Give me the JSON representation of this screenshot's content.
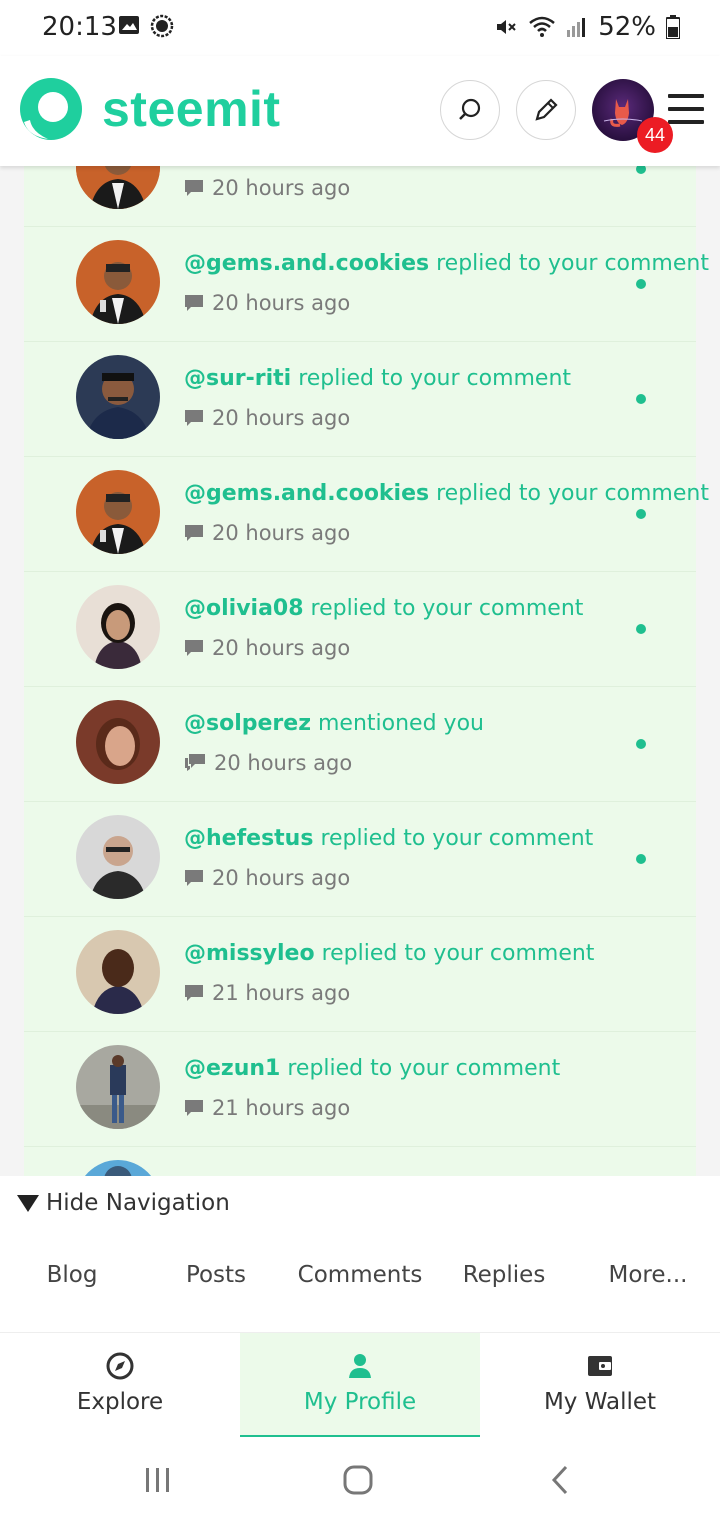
{
  "status_bar": {
    "time": "20:13",
    "battery": "52%",
    "icons": [
      "gallery-icon",
      "messenger-icon",
      "mute-icon",
      "wifi-icon",
      "signal-icon",
      "battery-icon"
    ]
  },
  "header": {
    "logo_text": "steemit",
    "notification_count": "44",
    "brand_color": "#1fcf9e"
  },
  "notifications": [
    {
      "user": "",
      "action": "",
      "time": "20 hours ago",
      "unread": true,
      "icon": "comment-icon"
    },
    {
      "user": "@gems.and.cookies",
      "action": "replied to your comment",
      "time": "20 hours ago",
      "unread": true,
      "icon": "comment-icon"
    },
    {
      "user": "@sur-riti",
      "action": "replied to your comment",
      "time": "20 hours ago",
      "unread": true,
      "icon": "comment-icon"
    },
    {
      "user": "@gems.and.cookies",
      "action": "replied to your comment",
      "time": "20 hours ago",
      "unread": true,
      "icon": "comment-icon"
    },
    {
      "user": "@olivia08",
      "action": "replied to your comment",
      "time": "20 hours ago",
      "unread": true,
      "icon": "comment-icon"
    },
    {
      "user": "@solperez",
      "action": "mentioned you",
      "time": "20 hours ago",
      "unread": true,
      "icon": "mention-icon"
    },
    {
      "user": "@hefestus",
      "action": "replied to your comment",
      "time": "20 hours ago",
      "unread": true,
      "icon": "comment-icon"
    },
    {
      "user": "@missyleo",
      "action": "replied to your comment",
      "time": "21 hours ago",
      "unread": false,
      "icon": "comment-icon"
    },
    {
      "user": "@ezun1",
      "action": "replied to your comment",
      "time": "21 hours ago",
      "unread": false,
      "icon": "comment-icon"
    }
  ],
  "hide_navigation": {
    "label": "Hide Navigation",
    "tabs": [
      "Blog",
      "Posts",
      "Comments",
      "Replies",
      "More..."
    ]
  },
  "bottom_tabs": [
    {
      "label": "Explore",
      "icon": "compass-icon",
      "active": false
    },
    {
      "label": "My Profile",
      "icon": "person-icon",
      "active": true
    },
    {
      "label": "My Wallet",
      "icon": "wallet-icon",
      "active": false
    }
  ],
  "system_nav": [
    "recents-icon",
    "home-icon",
    "back-icon"
  ]
}
